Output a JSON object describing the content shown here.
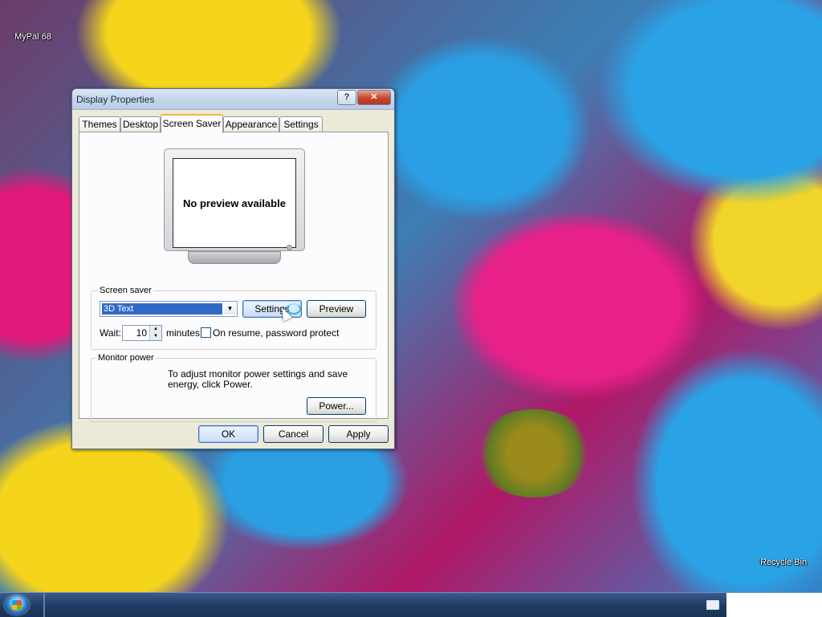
{
  "desktop": {
    "icons": [
      {
        "label": "MyPal 68"
      },
      {
        "label": "Recycle Bin"
      }
    ]
  },
  "window": {
    "title": "Display Properties",
    "help_label": "?",
    "close_label": "✕",
    "tabs": [
      {
        "label": "Themes"
      },
      {
        "label": "Desktop"
      },
      {
        "label": "Screen Saver",
        "active": true
      },
      {
        "label": "Appearance"
      },
      {
        "label": "Settings"
      }
    ],
    "preview_text": "No preview available",
    "screen_saver": {
      "group_label": "Screen saver",
      "selected": "3D Text",
      "settings_label": "Settings",
      "preview_label": "Preview",
      "wait_label": "Wait:",
      "wait_value": "10",
      "minutes_label": "minutes",
      "password_label": "On resume, password protect",
      "password_checked": false
    },
    "monitor_power": {
      "group_label": "Monitor power",
      "text": "To adjust monitor power settings and save energy, click Power.",
      "power_label": "Power..."
    },
    "buttons": {
      "ok": "OK",
      "cancel": "Cancel",
      "apply": "Apply"
    }
  },
  "colors": {
    "selection": "#316ac5",
    "tab_highlight": "#f4b63b",
    "close_red": "#c8432a"
  },
  "icons": {
    "start": "windows-start-orb",
    "keyboard": "keyboard-icon"
  }
}
